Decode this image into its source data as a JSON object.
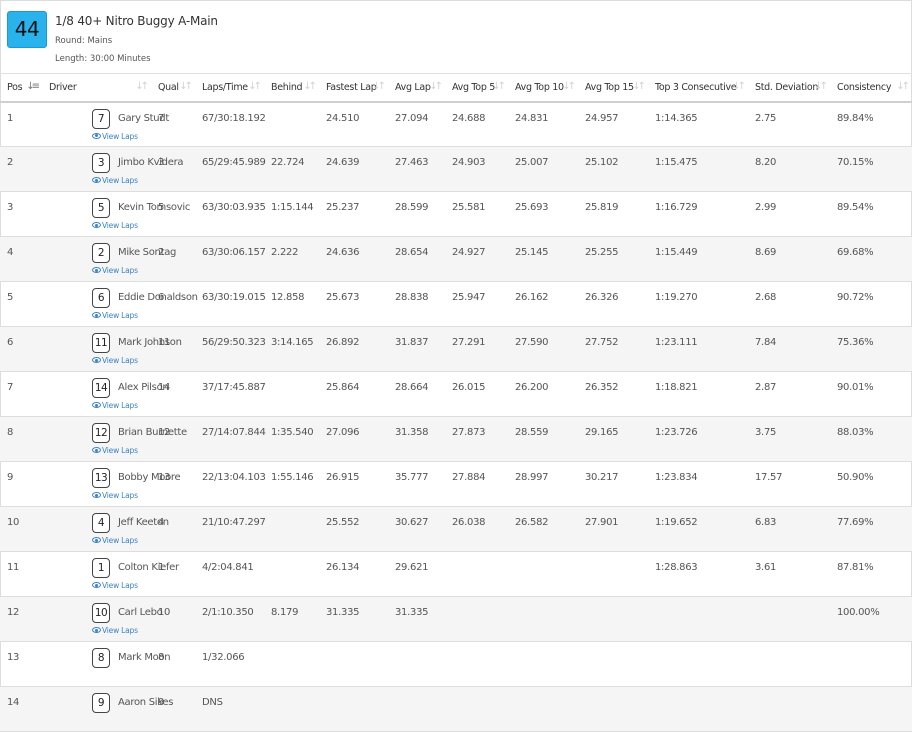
{
  "race": {
    "number": "44",
    "title": "1/8 40+ Nitro Buggy A-Main",
    "round": "Round: Mains",
    "length": "Length: 30:00 Minutes"
  },
  "columns": [
    {
      "key": "pos",
      "label": "Pos",
      "sort": "active"
    },
    {
      "key": "driver",
      "label": "Driver",
      "sort": "idle"
    },
    {
      "key": "qual",
      "label": "Qual",
      "sort": "idle"
    },
    {
      "key": "laps_time",
      "label": "Laps/Time",
      "sort": "idle"
    },
    {
      "key": "behind",
      "label": "Behind",
      "sort": "idle"
    },
    {
      "key": "fastest",
      "label": "Fastest Lap",
      "sort": "idle"
    },
    {
      "key": "avg",
      "label": "Avg Lap",
      "sort": "idle"
    },
    {
      "key": "top5",
      "label": "Avg Top 5",
      "sort": "idle"
    },
    {
      "key": "top10",
      "label": "Avg Top 10",
      "sort": "idle"
    },
    {
      "key": "top15",
      "label": "Avg Top 15",
      "sort": "idle"
    },
    {
      "key": "top3c",
      "label": "Top 3 Consecutive",
      "sort": "idle"
    },
    {
      "key": "std",
      "label": "Std. Deviation",
      "sort": "idle"
    },
    {
      "key": "consistency",
      "label": "Consistency",
      "sort": "idle"
    }
  ],
  "view_laps_label": "View Laps",
  "rows": [
    {
      "pos": "1",
      "car": "7",
      "driver": "Gary Studt",
      "qual": "7",
      "laps_time": "67/30:18.192",
      "behind": "",
      "fastest": "24.510",
      "avg": "27.094",
      "top5": "24.688",
      "top10": "24.831",
      "top15": "24.957",
      "top3c": "1:14.365",
      "std": "2.75",
      "consistency": "89.84%",
      "view_laps": true
    },
    {
      "pos": "2",
      "car": "3",
      "driver": "Jimbo Kvidera",
      "qual": "3",
      "laps_time": "65/29:45.989",
      "behind": "22.724",
      "fastest": "24.639",
      "avg": "27.463",
      "top5": "24.903",
      "top10": "25.007",
      "top15": "25.102",
      "top3c": "1:15.475",
      "std": "8.20",
      "consistency": "70.15%",
      "view_laps": true
    },
    {
      "pos": "3",
      "car": "5",
      "driver": "Kevin Tomsovic",
      "qual": "5",
      "laps_time": "63/30:03.935",
      "behind": "1:15.144",
      "fastest": "25.237",
      "avg": "28.599",
      "top5": "25.581",
      "top10": "25.693",
      "top15": "25.819",
      "top3c": "1:16.729",
      "std": "2.99",
      "consistency": "89.54%",
      "view_laps": true
    },
    {
      "pos": "4",
      "car": "2",
      "driver": "Mike Sontag",
      "qual": "2",
      "laps_time": "63/30:06.157",
      "behind": "2.222",
      "fastest": "24.636",
      "avg": "28.654",
      "top5": "24.927",
      "top10": "25.145",
      "top15": "25.255",
      "top3c": "1:15.449",
      "std": "8.69",
      "consistency": "69.68%",
      "view_laps": true
    },
    {
      "pos": "5",
      "car": "6",
      "driver": "Eddie Donaldson",
      "qual": "6",
      "laps_time": "63/30:19.015",
      "behind": "12.858",
      "fastest": "25.673",
      "avg": "28.838",
      "top5": "25.947",
      "top10": "26.162",
      "top15": "26.326",
      "top3c": "1:19.270",
      "std": "2.68",
      "consistency": "90.72%",
      "view_laps": true
    },
    {
      "pos": "6",
      "car": "11",
      "driver": "Mark Johnson",
      "qual": "11",
      "laps_time": "56/29:50.323",
      "behind": "3:14.165",
      "fastest": "26.892",
      "avg": "31.837",
      "top5": "27.291",
      "top10": "27.590",
      "top15": "27.752",
      "top3c": "1:23.111",
      "std": "7.84",
      "consistency": "75.36%",
      "view_laps": true
    },
    {
      "pos": "7",
      "car": "14",
      "driver": "Alex Pilson",
      "qual": "14",
      "laps_time": "37/17:45.887",
      "behind": "",
      "fastest": "25.864",
      "avg": "28.664",
      "top5": "26.015",
      "top10": "26.200",
      "top15": "26.352",
      "top3c": "1:18.821",
      "std": "2.87",
      "consistency": "90.01%",
      "view_laps": true
    },
    {
      "pos": "8",
      "car": "12",
      "driver": "Brian Burnette",
      "qual": "12",
      "laps_time": "27/14:07.844",
      "behind": "1:35.540",
      "fastest": "27.096",
      "avg": "31.358",
      "top5": "27.873",
      "top10": "28.559",
      "top15": "29.165",
      "top3c": "1:23.726",
      "std": "3.75",
      "consistency": "88.03%",
      "view_laps": true
    },
    {
      "pos": "9",
      "car": "13",
      "driver": "Bobby Moore",
      "qual": "13",
      "laps_time": "22/13:04.103",
      "behind": "1:55.146",
      "fastest": "26.915",
      "avg": "35.777",
      "top5": "27.884",
      "top10": "28.997",
      "top15": "30.217",
      "top3c": "1:23.834",
      "std": "17.57",
      "consistency": "50.90%",
      "view_laps": true
    },
    {
      "pos": "10",
      "car": "4",
      "driver": "Jeff Keeton",
      "qual": "4",
      "laps_time": "21/10:47.297",
      "behind": "",
      "fastest": "25.552",
      "avg": "30.627",
      "top5": "26.038",
      "top10": "26.582",
      "top15": "27.901",
      "top3c": "1:19.652",
      "std": "6.83",
      "consistency": "77.69%",
      "view_laps": true
    },
    {
      "pos": "11",
      "car": "1",
      "driver": "Colton Kiefer",
      "qual": "1",
      "laps_time": "4/2:04.841",
      "behind": "",
      "fastest": "26.134",
      "avg": "29.621",
      "top5": "",
      "top10": "",
      "top15": "",
      "top3c": "1:28.863",
      "std": "3.61",
      "consistency": "87.81%",
      "view_laps": true
    },
    {
      "pos": "12",
      "car": "10",
      "driver": "Carl Lebo",
      "qual": "10",
      "laps_time": "2/1:10.350",
      "behind": "8.179",
      "fastest": "31.335",
      "avg": "31.335",
      "top5": "",
      "top10": "",
      "top15": "",
      "top3c": "",
      "std": "",
      "consistency": "100.00%",
      "view_laps": true
    },
    {
      "pos": "13",
      "car": "8",
      "driver": "Mark Moon",
      "qual": "8",
      "laps_time": "1/32.066",
      "behind": "",
      "fastest": "",
      "avg": "",
      "top5": "",
      "top10": "",
      "top15": "",
      "top3c": "",
      "std": "",
      "consistency": "",
      "view_laps": false
    },
    {
      "pos": "14",
      "car": "9",
      "driver": "Aaron Sikes",
      "qual": "9",
      "laps_time": "DNS",
      "behind": "",
      "fastest": "",
      "avg": "",
      "top5": "",
      "top10": "",
      "top15": "",
      "top3c": "",
      "std": "",
      "consistency": "",
      "view_laps": false
    }
  ]
}
